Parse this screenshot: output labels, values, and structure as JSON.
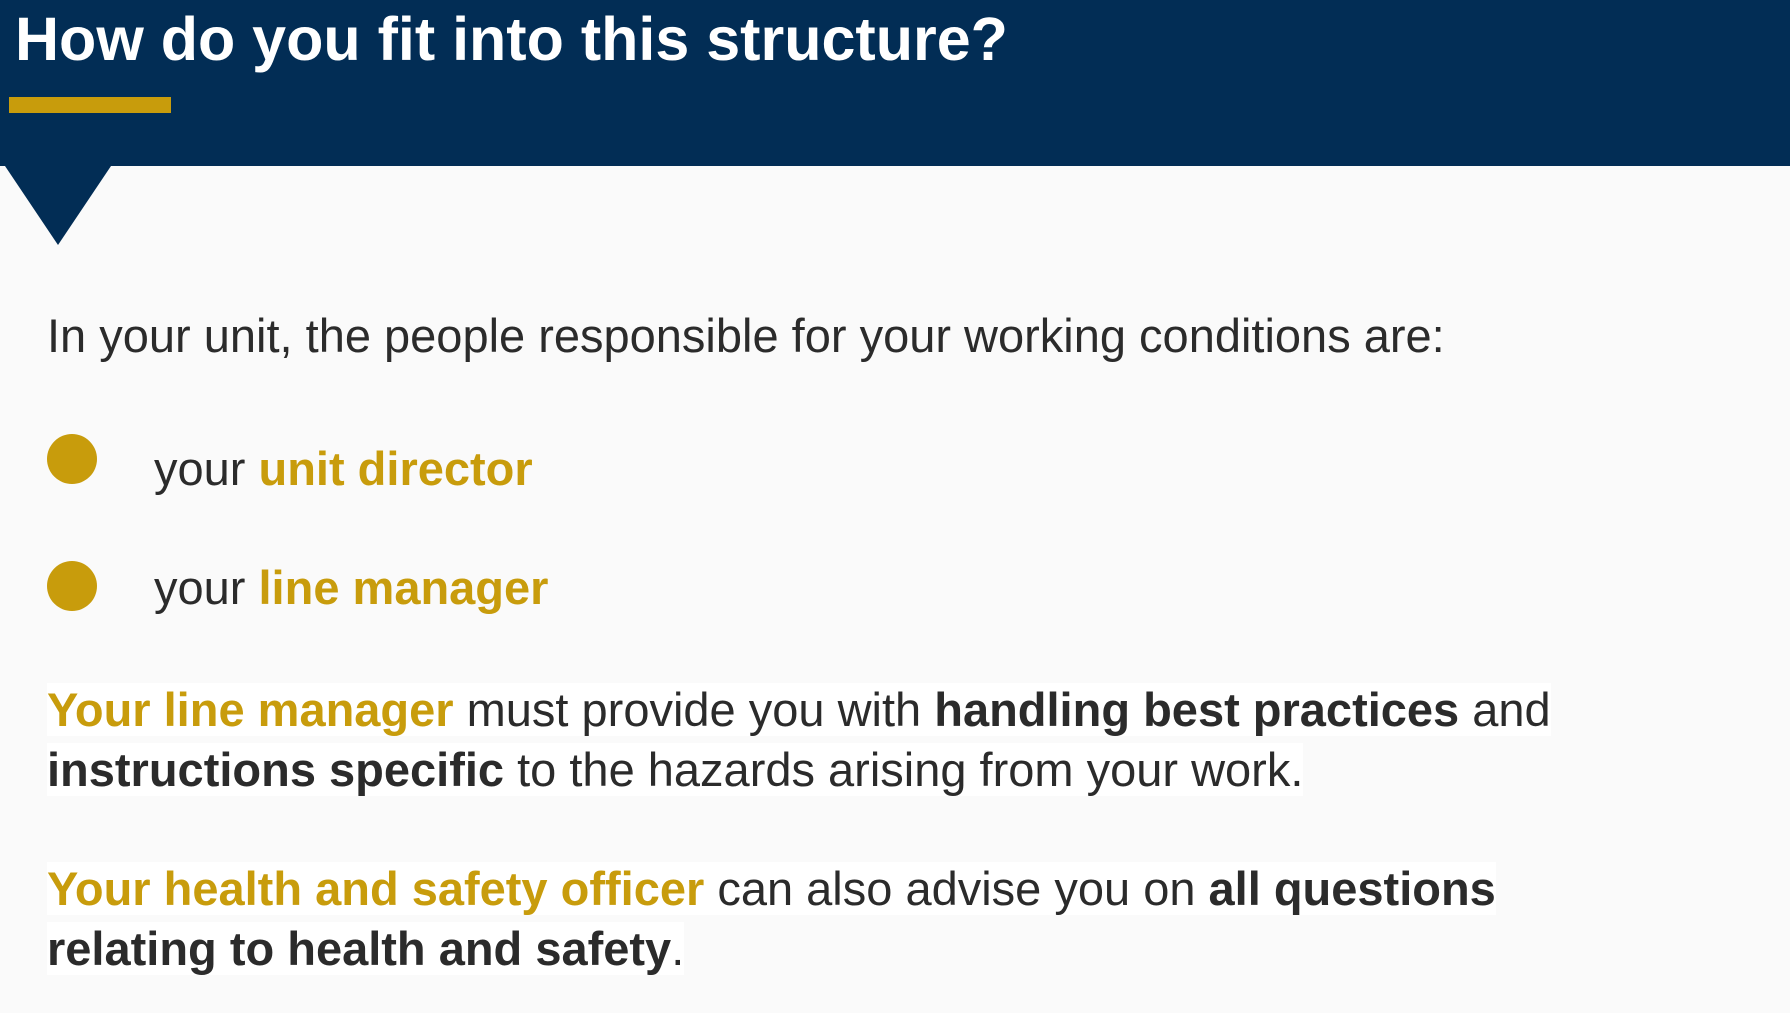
{
  "header": {
    "title": "How do you fit into this structure?"
  },
  "content": {
    "intro": "In your unit, the people responsible for your working conditions are:",
    "bullets": [
      {
        "prefix": "your ",
        "highlight": "unit director"
      },
      {
        "prefix": "your ",
        "highlight": "line manager"
      }
    ],
    "paragraph1": {
      "highlight": "Your line manager",
      "text1": " must provide you with ",
      "bold1": "handling best practices",
      "text2": " and",
      "bold2": "instructions specific",
      "text3": " to the hazards arising from your work."
    },
    "paragraph2": {
      "highlight": "Your health and safety officer",
      "text1": " can also advise you on ",
      "bold1": "all questions",
      "bold2": "relating to health and safety",
      "text2": "."
    }
  },
  "colors": {
    "header_bg": "#022d55",
    "accent": "#c89c0c",
    "text": "#2b2b2b",
    "page_bg": "#fafafa"
  }
}
